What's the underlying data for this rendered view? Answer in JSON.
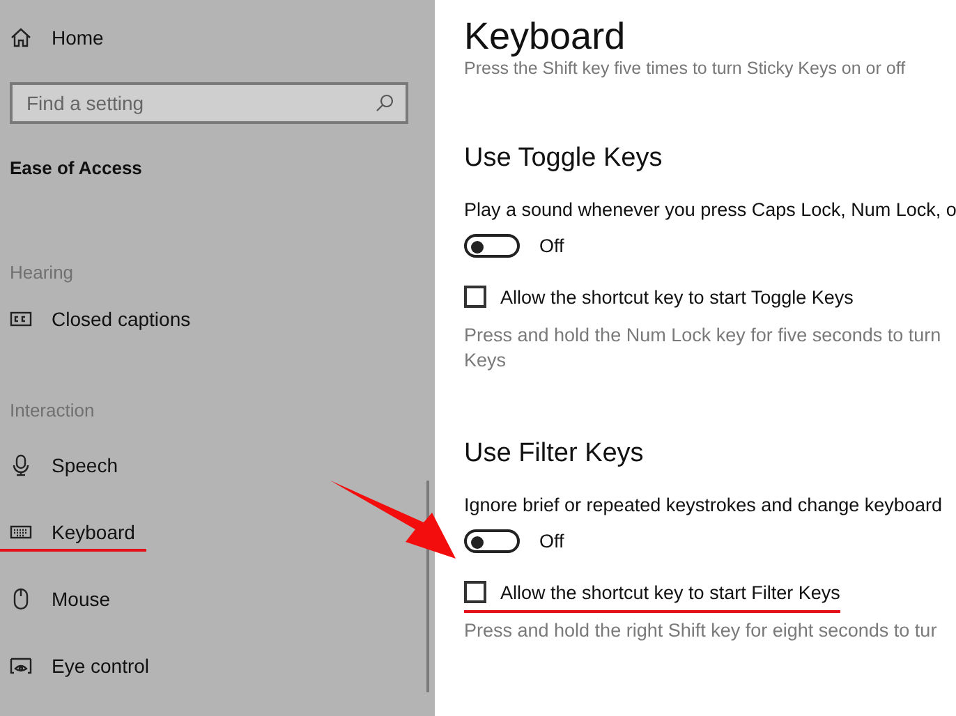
{
  "sidebar": {
    "home": "Home",
    "search": {
      "placeholder": "Find a setting"
    },
    "section_title": "Ease of Access",
    "groups": [
      {
        "heading": "Hearing",
        "items": [
          {
            "label": "Closed captions",
            "kind": "captions",
            "underlined": false
          }
        ]
      },
      {
        "heading": "Interaction",
        "items": [
          {
            "label": "Speech",
            "kind": "speech",
            "underlined": false
          },
          {
            "label": "Keyboard",
            "kind": "keyboard",
            "underlined": true
          },
          {
            "label": "Mouse",
            "kind": "mouse",
            "underlined": false
          },
          {
            "label": "Eye control",
            "kind": "eye",
            "underlined": false
          }
        ]
      }
    ]
  },
  "page": {
    "title": "Keyboard",
    "intro": "Press the Shift key five times to turn Sticky Keys on or off",
    "sections": [
      {
        "heading": "Use Toggle Keys",
        "toggle_label": "Play a sound whenever you press Caps Lock, Num Lock, o",
        "toggle": {
          "on": false,
          "text": "Off"
        },
        "checkbox": {
          "label": "Allow the shortcut key to start Toggle Keys",
          "checked": false,
          "underlined": false
        },
        "description": [
          "Press and hold the Num Lock key for five seconds to turn",
          "Keys"
        ]
      },
      {
        "heading": "Use Filter Keys",
        "toggle_label": "Ignore brief or repeated keystrokes and change keyboard",
        "toggle": {
          "on": false,
          "text": "Off"
        },
        "checkbox": {
          "label": "Allow the shortcut key to start Filter Keys",
          "checked": false,
          "underlined": true
        },
        "description": [
          "Press and hold the right Shift key for eight seconds to tur"
        ]
      }
    ]
  },
  "annotations": [
    {
      "kind": "arrow"
    }
  ]
}
